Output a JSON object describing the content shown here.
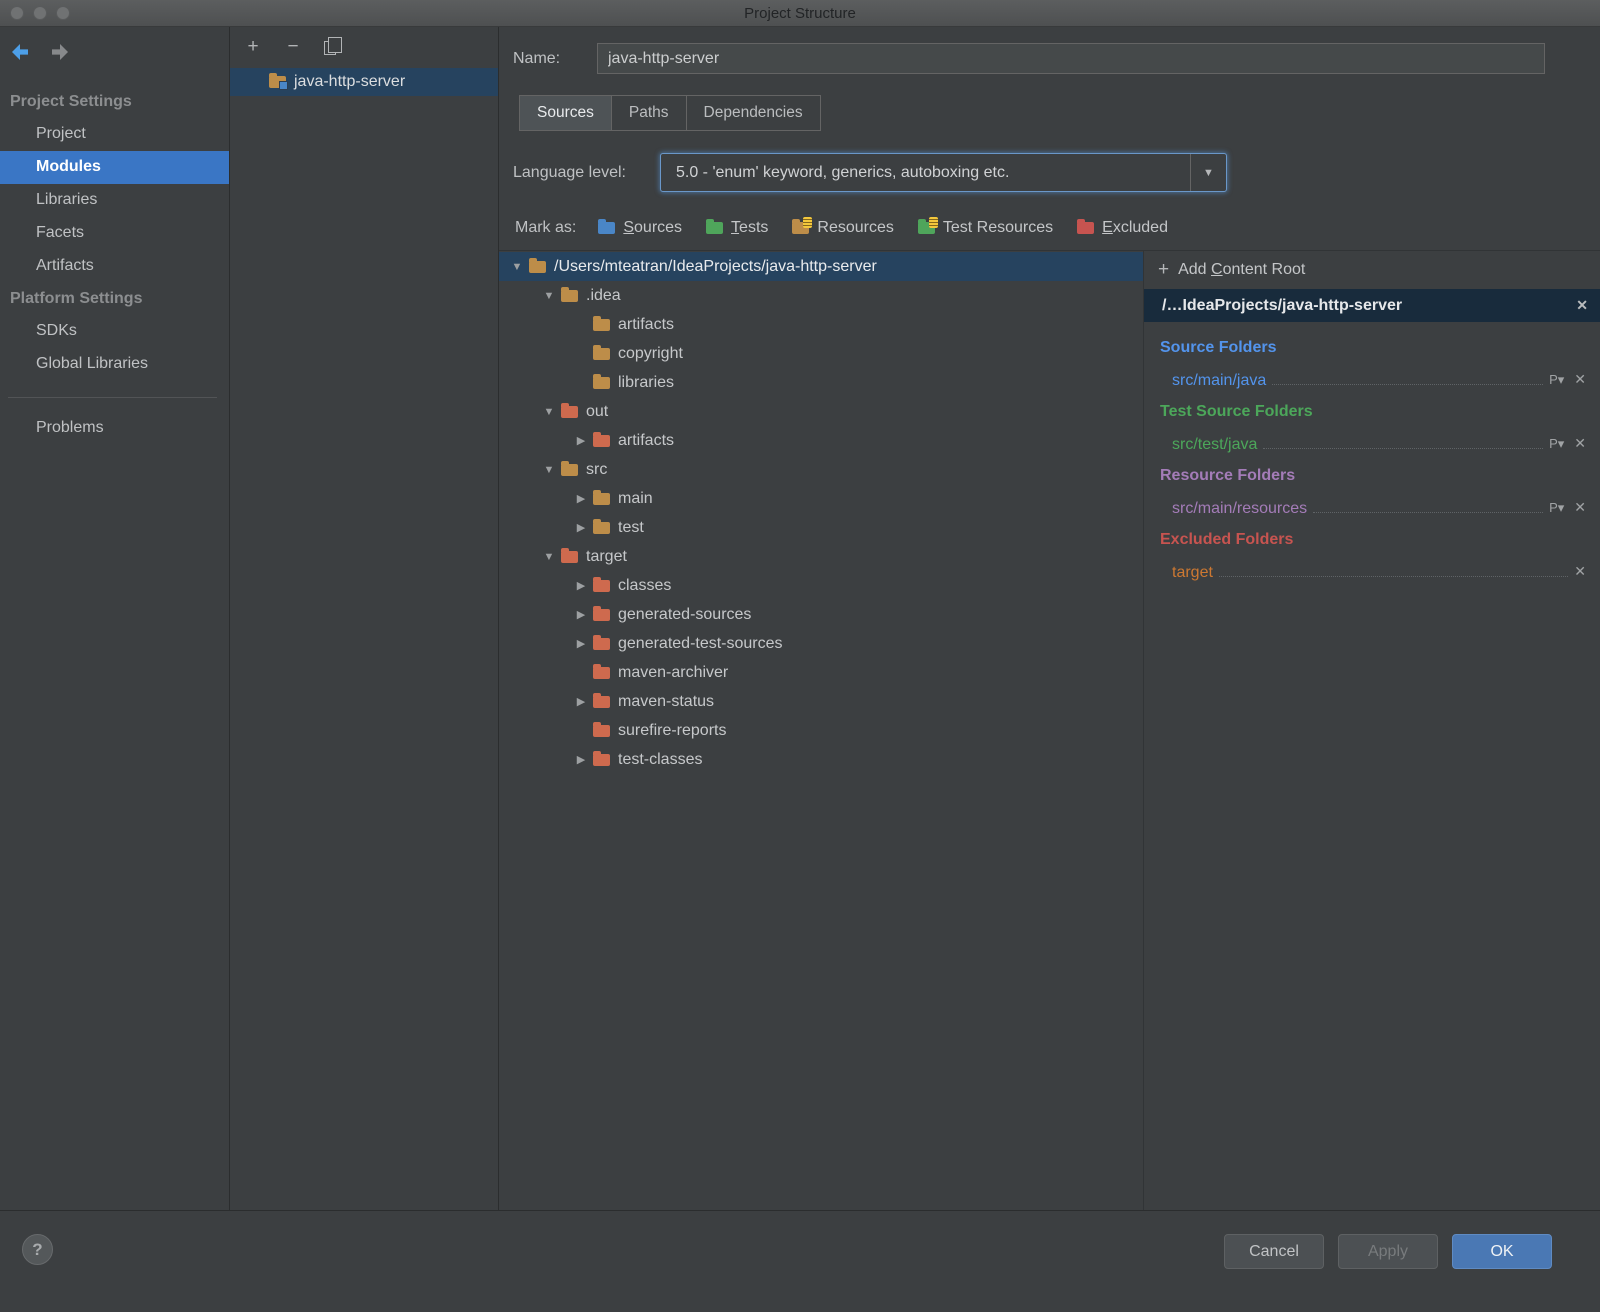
{
  "window": {
    "title": "Project Structure"
  },
  "icons": {
    "plus": "+",
    "minus": "−",
    "add": "+",
    "close": "✕",
    "dropdown_arrow": "▼",
    "tree_expanded": "▼",
    "tree_collapsed": "▶",
    "props": "P",
    "props_arrow": "▾",
    "help": "?"
  },
  "colors": {
    "panel_bg": "#3c3f41",
    "sidebar_selection_blue": "#3a76c5",
    "tree_selection_blue": "#26435f",
    "content_root_row_bg": "#182b3c",
    "source_blue": "#5394ec",
    "test_green": "#4ca75a",
    "resource_purple": "#a47cb8",
    "excluded_red": "#c75450",
    "excluded_item_orange": "#cc7832",
    "ok_button_blue": "#4a78b4"
  },
  "sidebar": {
    "sections": [
      {
        "header": "Project Settings",
        "items": [
          "Project",
          "Modules",
          "Libraries",
          "Facets",
          "Artifacts"
        ]
      },
      {
        "header": "Platform Settings",
        "items": [
          "SDKs",
          "Global Libraries"
        ]
      }
    ],
    "problems": "Problems",
    "selected_item": "Modules"
  },
  "modules_panel": {
    "items": [
      "java-http-server"
    ],
    "selected": "java-http-server"
  },
  "form": {
    "name_label": "Name:",
    "name_value": "java-http-server",
    "tabs": [
      "Sources",
      "Paths",
      "Dependencies"
    ],
    "selected_tab": "Sources",
    "language_level_label": "Language level:",
    "language_level_value": "5.0 - 'enum' keyword, generics, autoboxing etc.",
    "mark_as_label": "Mark as:",
    "mark_as": {
      "sources": {
        "key": "S",
        "rest": "ources"
      },
      "tests": {
        "key": "T",
        "rest": "ests"
      },
      "resources": "Resources",
      "test_resources": "Test Resources",
      "excluded": {
        "key": "E",
        "rest": "xcluded"
      }
    }
  },
  "tree": {
    "rows": [
      "/Users/mteatran/IdeaProjects/java-http-server",
      ".idea",
      "artifacts",
      "copyright",
      "libraries",
      "out",
      "artifacts",
      "src",
      "main",
      "test",
      "target",
      "classes",
      "generated-sources",
      "generated-test-sources",
      "maven-archiver",
      "maven-status",
      "surefire-reports",
      "test-classes"
    ]
  },
  "content_roots": {
    "add": {
      "pre": "Add ",
      "key": "C",
      "rest": "ontent Root"
    },
    "root_path": "/…IdeaProjects/java-http-server",
    "sections": [
      {
        "title": "Source Folders",
        "items": [
          "src/main/java"
        ]
      },
      {
        "title": "Test Source Folders",
        "items": [
          "src/test/java"
        ]
      },
      {
        "title": "Resource Folders",
        "items": [
          "src/main/resources"
        ]
      },
      {
        "title": "Excluded Folders",
        "items": [
          "target"
        ]
      }
    ]
  },
  "footer": {
    "cancel": "Cancel",
    "apply": "Apply",
    "ok": "OK"
  }
}
